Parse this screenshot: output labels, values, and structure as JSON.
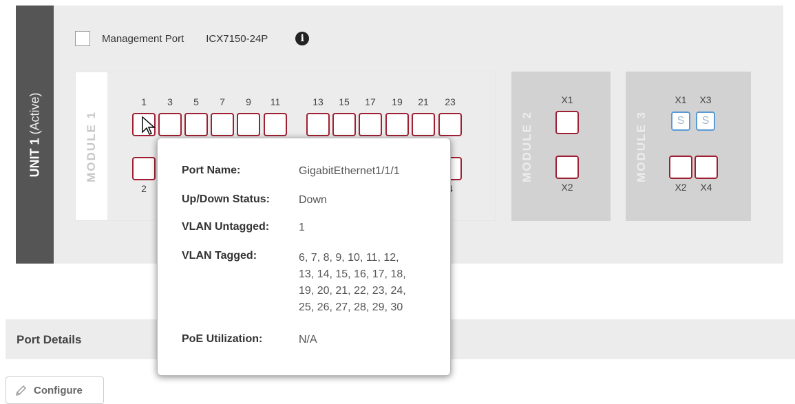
{
  "unit": {
    "label": "UNIT 1",
    "state": "(Active)"
  },
  "management": {
    "checkbox_label": "Management Port",
    "model": "ICX7150-24P",
    "info_icon": "info-icon"
  },
  "module1": {
    "label": "MODULE 1",
    "top_labels": [
      "1",
      "3",
      "5",
      "7",
      "9",
      "11",
      "13",
      "15",
      "17",
      "19",
      "21",
      "23"
    ],
    "bottom_visible_labels": [
      "2",
      "4"
    ]
  },
  "module2": {
    "label": "MODULE 2",
    "top_label": "X1",
    "bottom_label": "X2"
  },
  "module3": {
    "label": "MODULE 3",
    "top_labels": [
      "X1",
      "X3"
    ],
    "stack_badges": [
      "S",
      "S"
    ],
    "bottom_labels": [
      "X2",
      "X4"
    ]
  },
  "tooltip": {
    "rows": [
      {
        "key": "Port Name:",
        "value": "GigabitEthernet1/1/1"
      },
      {
        "key": "Up/Down Status:",
        "value": "Down"
      },
      {
        "key": "VLAN Untagged:",
        "value": "1"
      },
      {
        "key": "VLAN Tagged:",
        "value_lines": [
          "6, 7, 8, 9, 10, 11, 12,",
          "13, 14, 15, 16, 17, 18,",
          "19, 20, 21, 22, 23, 24,",
          "25, 26, 27, 28, 29, 30"
        ]
      },
      {
        "key": "PoE Utilization:",
        "value": "N/A"
      }
    ]
  },
  "port_details": {
    "title": "Port Details"
  },
  "configure_button": {
    "label": "Configure",
    "icon": "pencil-icon"
  },
  "colors": {
    "port_border": "#a02033",
    "stack_port_border": "#5b9bd5",
    "unit_label_bg": "#555555"
  }
}
